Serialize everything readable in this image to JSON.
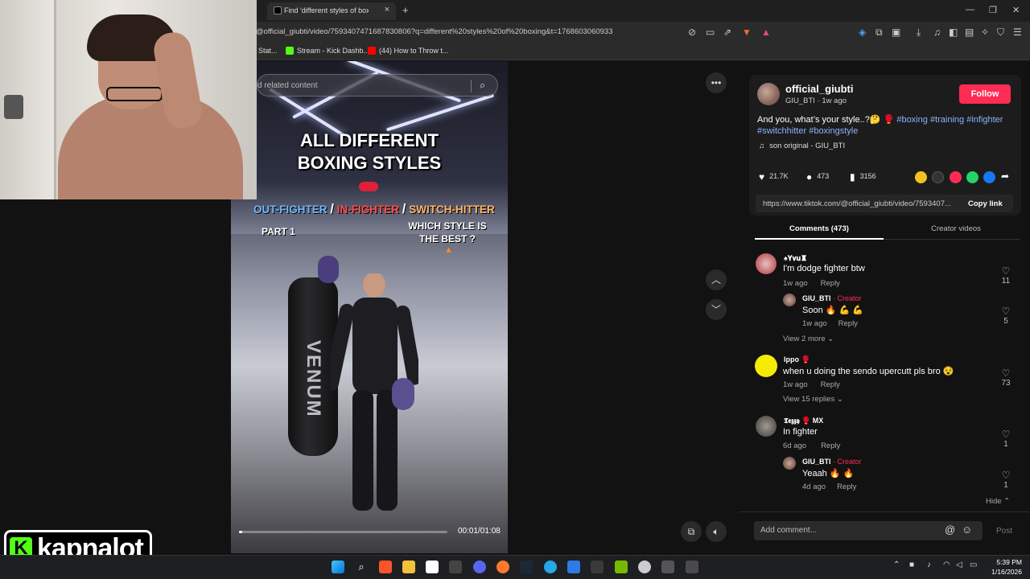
{
  "browser": {
    "tab_title": "Find 'different styles of boxing'",
    "url": "@official_giubti/video/7593407471687830806?q=different%20styles%20of%20boxing&t=1768603060933",
    "bookmarks": [
      "Stat...",
      "Stream - Kick Dashb...",
      "(44) How to Throw t..."
    ],
    "new_tab": "+",
    "win_minimize": "—",
    "win_restore": "❐",
    "win_close": "✕"
  },
  "video": {
    "search_placeholder": "d related content",
    "title_line1": "ALL DIFFERENT",
    "title_line2": "BOXING STYLES",
    "style_out": "OUT-FIGHTER",
    "style_slash": "/",
    "style_in": "IN-FIGHTER",
    "style_switch": "SWITCH-HITTER",
    "part": "PART 1",
    "question_line1": "WHICH STYLE IS",
    "question_line2": "THE BEST ?",
    "bag_brand": "VENUM",
    "timecode": "00:01/01:08",
    "progress_fraction": 0.015
  },
  "streamer": {
    "badge": "K",
    "name": "kapnalot"
  },
  "post": {
    "author": "official_giubti",
    "author_meta": "GIU_BTI · 1w ago",
    "follow_label": "Follow",
    "caption_text": "And you, what’s your style..?🤔 🥊 ",
    "hashtags": [
      "#boxing",
      "#training",
      "#infighter",
      "#switchhitter",
      "#boxingstyle"
    ],
    "sound": "son original - GIU_BTI",
    "likes": "21.7K",
    "comments": "473",
    "saves": "3156",
    "link": "https://www.tiktok.com/@official_giubti/video/7593407...",
    "copy_label": "Copy link",
    "tab_comments": "Comments (473)",
    "tab_creator": "Creator videos"
  },
  "comments": [
    {
      "name": "♠𝐘𝐯𝐮♜",
      "text": "I'm dodge fighter btw",
      "age": "1w ago",
      "reply": "Reply",
      "likes": "11"
    },
    {
      "name": "GIU_BTI",
      "creator": "· Creator",
      "text": "Soon 🔥 💪 💪",
      "age": "1w ago",
      "reply": "Reply",
      "likes": "5"
    },
    {
      "more": "View 2 more"
    },
    {
      "name": "Ippo 🥊",
      "text": "when u doing the sendo upercutt pls bro 😵",
      "age": "1w ago",
      "reply": "Reply",
      "likes": "73"
    },
    {
      "more": "View 15 replies"
    },
    {
      "name": "𝕿𝖊𝖟𝖟𝖞 🥊 MX",
      "text": "In fighter",
      "age": "6d ago",
      "reply": "Reply",
      "likes": "1"
    },
    {
      "name": "GIU_BTI",
      "creator": "· Creator",
      "text": "Yeaah 🔥 🔥",
      "age": "4d ago",
      "reply": "Reply",
      "likes": "1"
    },
    {
      "more": "Hide"
    }
  ],
  "comment_input": {
    "placeholder": "Add comment...",
    "post_label": "Post"
  },
  "taskbar": {
    "time": "5:39 PM",
    "date": "1/16/2026"
  },
  "colors": {
    "accent": "#fe2c55",
    "hashtag": "#8ab4ff",
    "kick_green": "#53fc18",
    "out_fighter": "#6fb7ff",
    "in_fighter": "#ff4d4d",
    "switch_hitter": "#ffb36b"
  }
}
